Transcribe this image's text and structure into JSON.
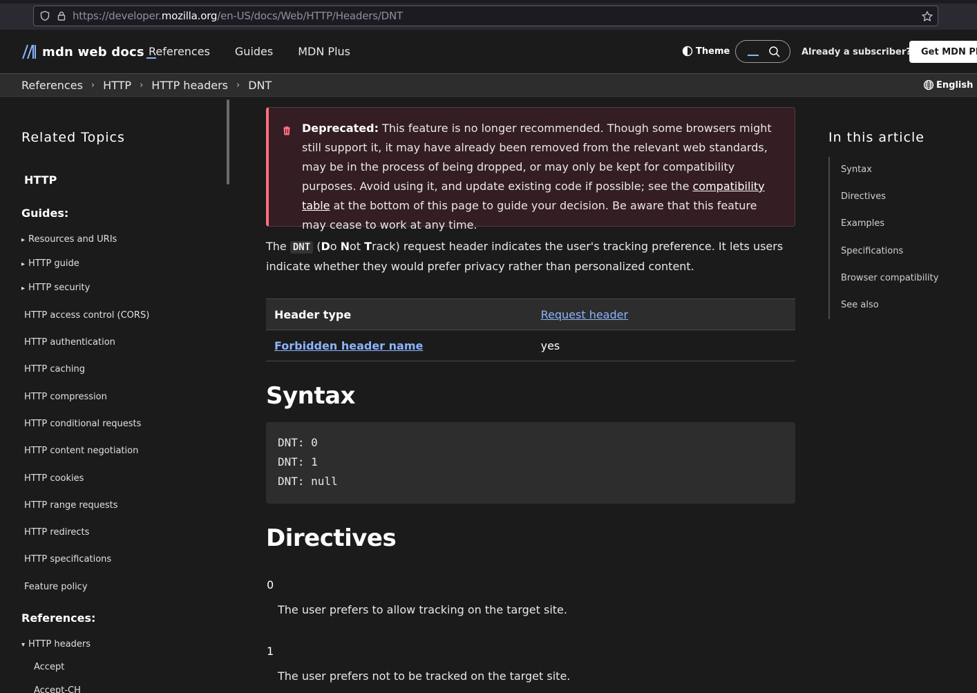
{
  "browser": {
    "url_prefix": "https://developer.",
    "url_domain": "mozilla.org",
    "url_path": "/en-US/docs/Web/HTTP/Headers/DNT"
  },
  "header": {
    "logo_text": "mdn web docs",
    "nav": [
      "References",
      "Guides",
      "MDN Plus"
    ],
    "theme_label": "Theme",
    "subscriber_label": "Already a subscriber?",
    "get_plus_label": "Get MDN Plus",
    "accent_color": "#8cb4ff"
  },
  "breadcrumb": [
    "References",
    "HTTP",
    "HTTP headers",
    "DNT"
  ],
  "language": "English (US)",
  "sidebar": {
    "title": "Related Topics",
    "section": "HTTP",
    "guides_heading": "Guides:",
    "collapsed_groups": [
      "Resources and URIs",
      "HTTP guide",
      "HTTP security"
    ],
    "items": [
      "HTTP access control (CORS)",
      "HTTP authentication",
      "HTTP caching",
      "HTTP compression",
      "HTTP conditional requests",
      "HTTP content negotiation",
      "HTTP cookies",
      "HTTP range requests",
      "HTTP redirects",
      "HTTP specifications",
      "Feature policy"
    ],
    "references_heading": "References:",
    "open_group": "HTTP headers",
    "sub_items": [
      "Accept",
      "Accept-CH"
    ]
  },
  "deprecated": {
    "label": "Deprecated:",
    "text_before": " This feature is no longer recommended. Though some browsers might still support it, it may have already been removed from the relevant web standards, may be in the process of being dropped, or may only be kept for compatibility purposes. Avoid using it, and update existing code if possible; see the ",
    "link": "compatibility table",
    "text_after": " at the bottom of this page to guide your decision. Be aware that this feature may cease to work at any time.",
    "accent_color": "#ff707f"
  },
  "intro": {
    "t1": "The ",
    "code": "DNT",
    "t2": " (",
    "d": "D",
    "t3": "o ",
    "n": "N",
    "t4": "ot ",
    "tt": "T",
    "t5": "rack) request header indicates the user's tracking preference. It lets users indicate whether they would prefer privacy rather than personalized content."
  },
  "table": {
    "row1_label": "Header type",
    "row1_value": "Request header",
    "row2_label": "Forbidden header name",
    "row2_value": "yes"
  },
  "syntax": {
    "heading": "Syntax",
    "lines": [
      "DNT: 0",
      "DNT: 1",
      "DNT: null"
    ]
  },
  "directives": {
    "heading": "Directives",
    "items": [
      {
        "term": "0",
        "desc": "The user prefers to allow tracking on the target site."
      },
      {
        "term": "1",
        "desc": "The user prefers not to be tracked on the target site."
      }
    ]
  },
  "toc": {
    "title": "In this article",
    "items": [
      "Syntax",
      "Directives",
      "Examples",
      "Specifications",
      "Browser compatibility",
      "See also"
    ]
  }
}
